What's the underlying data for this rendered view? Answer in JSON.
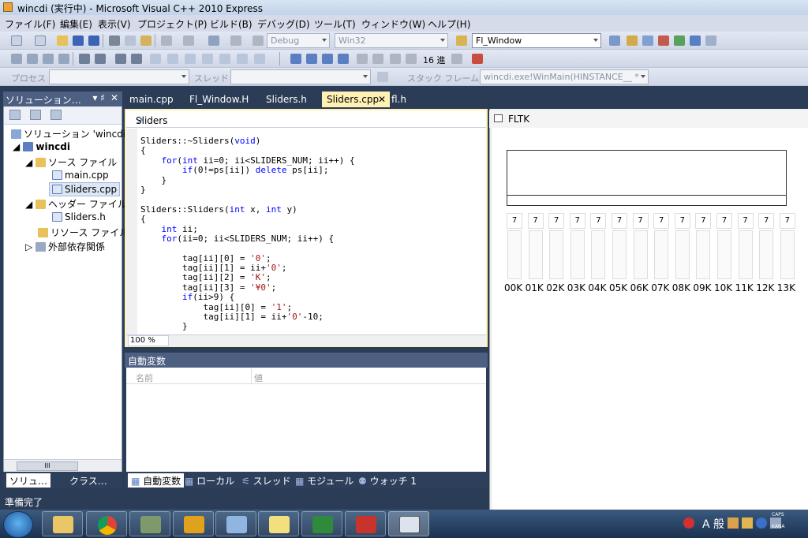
{
  "window": {
    "title": "wincdi (実行中) - Microsoft Visual C++ 2010 Express"
  },
  "menu": [
    "ファイル(F)",
    "編集(E)",
    "表示(V)",
    "プロジェクト(P)",
    "ビルド(B)",
    "デバッグ(D)",
    "ツール(T)",
    "ウィンドウ(W)",
    "ヘルプ(H)"
  ],
  "toolbar": {
    "config": "Debug",
    "platform": "Win32",
    "find": "Fl_Window",
    "hex_label": "16 進",
    "process_label": "プロセス",
    "thread_label": "スレッド",
    "stackframe_label": "スタック フレーム",
    "stackframe_value": "wincdi.exe!WinMain(HINSTANCE__ *"
  },
  "solution": {
    "panel_title": "ソリューション…",
    "root": "ソリューション 'wincdi'",
    "project": "wincdi",
    "source_folder": "ソース ファイル",
    "source_files": [
      "main.cpp",
      "Sliders.cpp"
    ],
    "header_folder": "ヘッダー ファイル",
    "header_files": [
      "Sliders.h"
    ],
    "resource_folder": "リソース ファイル",
    "external": "外部依存関係",
    "tabs": [
      "ソリュ…",
      "クラス…"
    ],
    "scroll_mark": "III"
  },
  "doc_tabs": [
    "main.cpp",
    "Fl_Window.H",
    "Sliders.h",
    "Sliders.cpp",
    "fl.h"
  ],
  "editor": {
    "nav": "Sliders",
    "zoom": "100 %",
    "lines": [
      "Sliders::~Sliders(void)",
      "{",
      "    for(int ii=0; ii<SLIDERS_NUM; ii++) {",
      "        if(0!=ps[ii]) delete ps[ii];",
      "    }",
      "}",
      "",
      "Sliders::Sliders(int x, int y)",
      "{",
      "    int ii;",
      "    for(ii=0; ii<SLIDERS_NUM; ii++) {",
      "",
      "        tag[ii][0] = '0';",
      "        tag[ii][1] = ii+'0';",
      "        tag[ii][2] = 'K';",
      "        tag[ii][3] = '¥0';",
      "        if(ii>9) {",
      "            tag[ii][0] = '1';",
      "            tag[ii][1] = ii+'0'-10;",
      "        }"
    ]
  },
  "autos": {
    "title": "自動変数",
    "col_name": "名前",
    "col_value": "値",
    "tabs": [
      "自動変数",
      "ローカル",
      "スレッド",
      "モジュール",
      "ウォッチ 1"
    ]
  },
  "status": "準備完了",
  "fltk": {
    "title": "FLTK",
    "sliders": [
      {
        "value": "7",
        "label": "00K"
      },
      {
        "value": "7",
        "label": "01K"
      },
      {
        "value": "7",
        "label": "02K"
      },
      {
        "value": "7",
        "label": "03K"
      },
      {
        "value": "7",
        "label": "04K"
      },
      {
        "value": "7",
        "label": "05K"
      },
      {
        "value": "7",
        "label": "06K"
      },
      {
        "value": "7",
        "label": "07K"
      },
      {
        "value": "7",
        "label": "08K"
      },
      {
        "value": "7",
        "label": "09K"
      },
      {
        "value": "7",
        "label": "10K"
      },
      {
        "value": "7",
        "label": "11K"
      },
      {
        "value": "7",
        "label": "12K"
      },
      {
        "value": "7",
        "label": "13K"
      }
    ]
  },
  "tray": {
    "ime": "A 般",
    "caps": "CAPS",
    "kana": "KANA"
  }
}
